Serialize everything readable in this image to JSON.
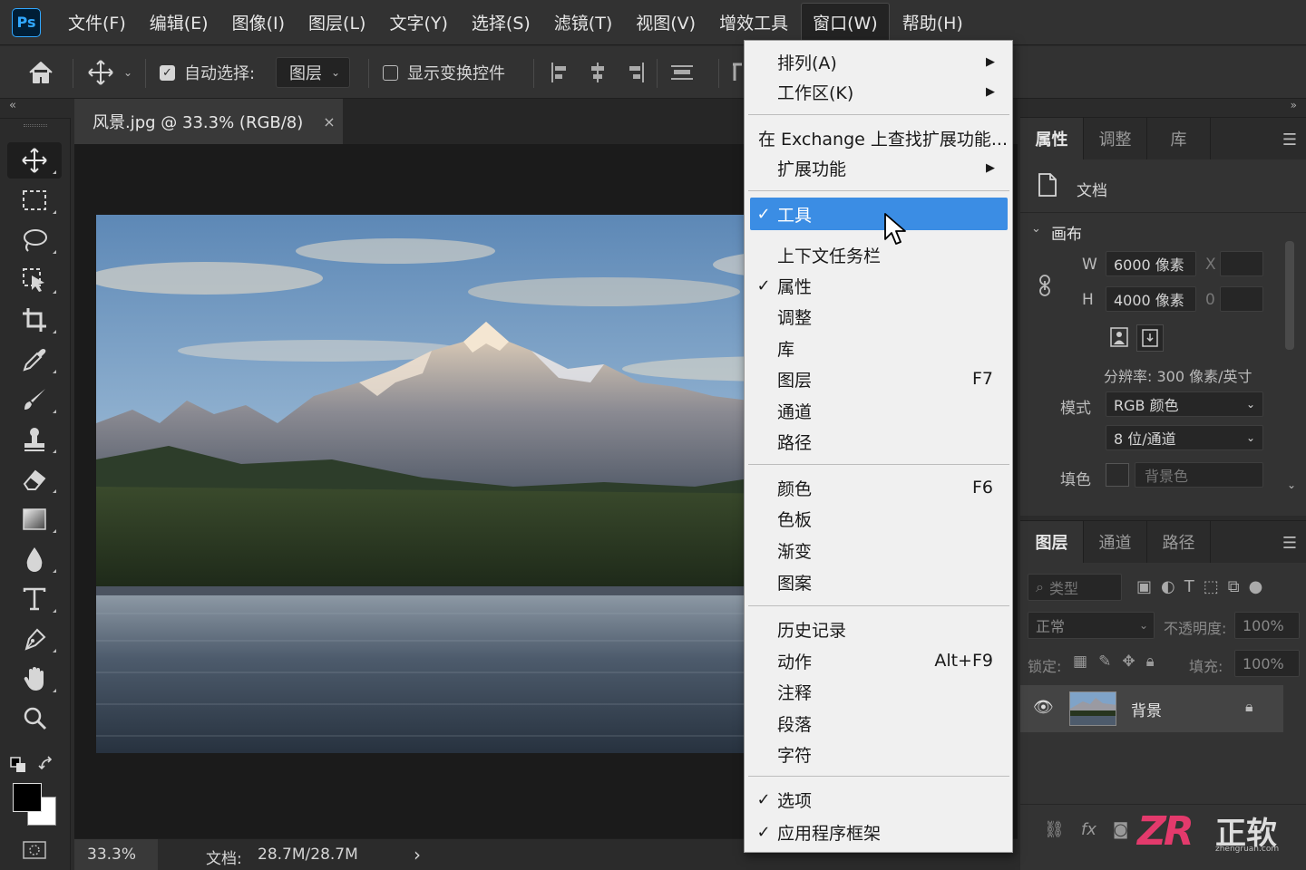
{
  "app": {
    "logo": "Ps"
  },
  "menubar": {
    "items": [
      "文件(F)",
      "编辑(E)",
      "图像(I)",
      "图层(L)",
      "文字(Y)",
      "选择(S)",
      "滤镜(T)",
      "视图(V)",
      "增效工具",
      "窗口(W)",
      "帮助(H)"
    ],
    "active": "窗口(W)"
  },
  "options_bar": {
    "auto_select_label": "自动选择:",
    "auto_select_checked": true,
    "auto_select_target": "图层",
    "show_transform_label": "显示变换控件",
    "show_transform_checked": false
  },
  "toolbar": {
    "collapse": "«",
    "tools": [
      "move-tool",
      "marquee-tool",
      "lasso-tool",
      "object-selection-tool",
      "crop-tool",
      "eyedropper-tool",
      "brush-tool",
      "stamp-tool",
      "eraser-tool",
      "gradient-tool",
      "blur-tool",
      "type-tool",
      "pen-tool",
      "hand-tool",
      "zoom-tool"
    ],
    "foreground_color": "#000000",
    "background_color": "#ffffff"
  },
  "document": {
    "tab_title": "风景.jpg @ 33.3% (RGB/8)",
    "close": "×",
    "zoom": "33.3%",
    "doc_size_label": "文档:",
    "doc_size": "28.7M/28.7M",
    "status_arrow": "›"
  },
  "properties_panel": {
    "collapse": "»",
    "tabs": [
      "属性",
      "调整",
      "库"
    ],
    "active_tab": "属性",
    "doc_label": "文档",
    "section": "画布",
    "width_label": "W",
    "width": "6000 像素",
    "height_label": "H",
    "height": "4000 像素",
    "x_label": "X",
    "y_label": "0",
    "resolution": "分辨率: 300 像素/英寸",
    "mode_label": "模式",
    "mode": "RGB 颜色",
    "depth": "8 位/通道",
    "fill_label": "填色",
    "fill_value": "背景色"
  },
  "layers_panel": {
    "tabs": [
      "图层",
      "通道",
      "路径"
    ],
    "active_tab": "图层",
    "filter_placeholder": "类型",
    "blend_mode": "正常",
    "opacity_label": "不透明度:",
    "opacity": "100%",
    "lock_label": "锁定:",
    "fill_label": "填充:",
    "fill": "100%",
    "layers": [
      {
        "name": "背景",
        "visible": true,
        "locked": true
      }
    ]
  },
  "window_menu": {
    "items": [
      {
        "label": "排列(A)",
        "submenu": true
      },
      {
        "label": "工作区(K)",
        "submenu": true
      },
      {
        "label": "在 Exchange 上查找扩展功能..."
      },
      {
        "label": "扩展功能",
        "submenu": true
      },
      {
        "label": "工具",
        "checked": true,
        "highlighted": true
      },
      {
        "label": "上下文任务栏"
      },
      {
        "label": "属性",
        "checked": true
      },
      {
        "label": "调整"
      },
      {
        "label": "库"
      },
      {
        "label": "图层",
        "shortcut": "F7"
      },
      {
        "label": "通道"
      },
      {
        "label": "路径"
      },
      {
        "label": "颜色",
        "shortcut": "F6"
      },
      {
        "label": "色板"
      },
      {
        "label": "渐变"
      },
      {
        "label": "图案"
      },
      {
        "label": "历史记录"
      },
      {
        "label": "动作",
        "shortcut": "Alt+F9"
      },
      {
        "label": "注释"
      },
      {
        "label": "段落"
      },
      {
        "label": "字符"
      },
      {
        "label": "选项",
        "checked": true
      },
      {
        "label": "应用程序框架",
        "checked": true
      }
    ]
  },
  "watermark": {
    "brand": "ZR",
    "name": "正软",
    "url": "zhengruan.com"
  },
  "colors": {
    "highlight": "#3b8de4",
    "ps_blue": "#31a8ff",
    "ps_bg": "#001e36"
  }
}
